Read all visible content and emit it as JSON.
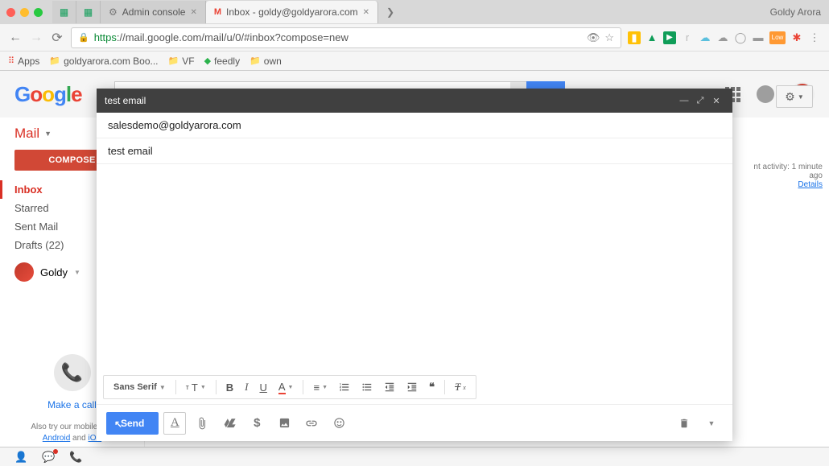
{
  "browser": {
    "profile": "Goldy Arora",
    "tabs": [
      {
        "label": "Admin console",
        "active": false
      },
      {
        "label": "Inbox - goldy@goldyarora.com",
        "active": true
      }
    ],
    "url_secure": "https",
    "url_host": "://mail.google.com",
    "url_path": "/mail/u/0/#inbox?compose=new",
    "bookmarks": {
      "apps": "Apps",
      "items": [
        "goldyarora.com Boo...",
        "VF",
        "feedly",
        "own"
      ]
    }
  },
  "gmail": {
    "mail_label": "Mail",
    "compose": "COMPOSE",
    "nav": [
      {
        "label": "Inbox",
        "active": true
      },
      {
        "label": "Starred",
        "active": false
      },
      {
        "label": "Sent Mail",
        "active": false
      },
      {
        "label": "Drafts (22)",
        "active": false
      }
    ],
    "user": "Goldy",
    "call": "Make a call",
    "mobile_prefix": "Also try our mobile app",
    "mobile_android": "Android",
    "mobile_and": " and ",
    "mobile_ios": "iOS",
    "activity": "nt activity: 1 minute ago",
    "details": "Details"
  },
  "compose": {
    "title": "test email",
    "to": "salesdemo@goldyarora.com",
    "subject": "test email",
    "font": "Sans Serif",
    "send": "Send"
  }
}
